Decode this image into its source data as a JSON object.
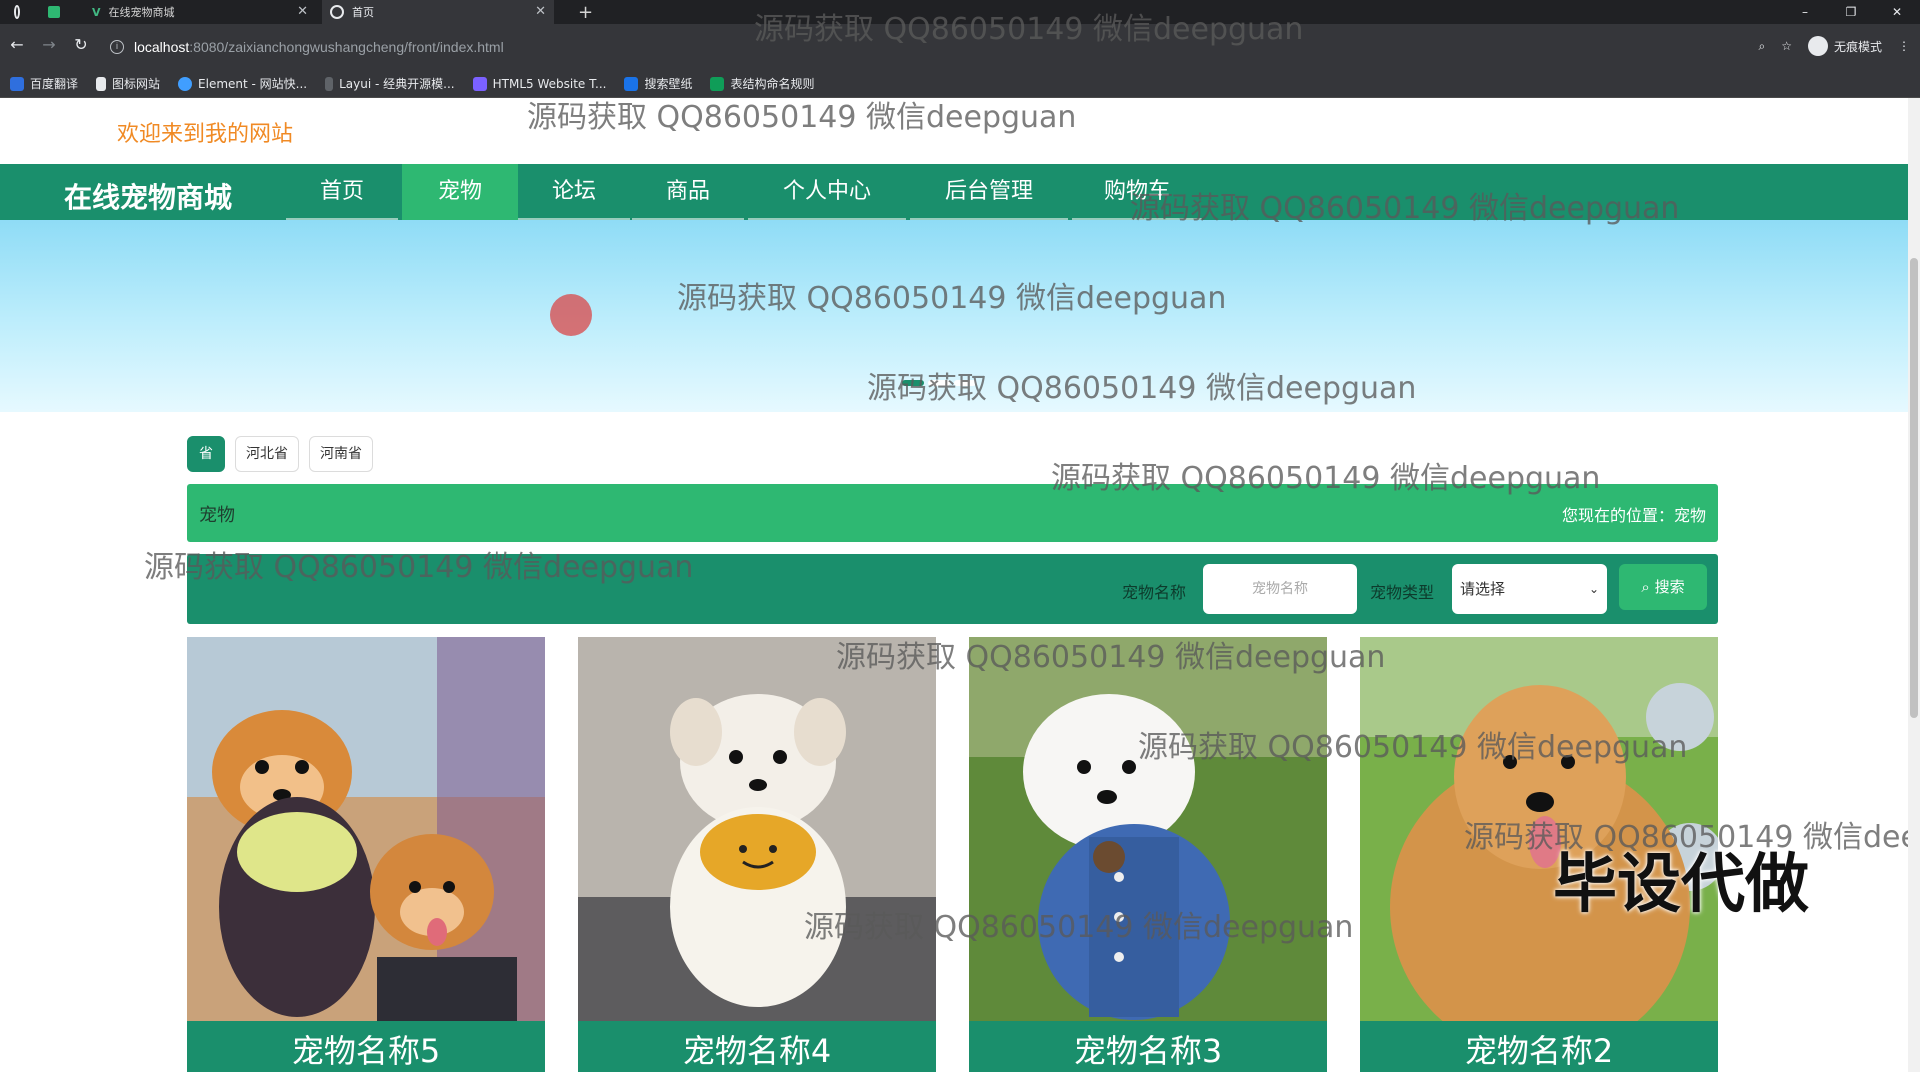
{
  "browser": {
    "tabs": [
      {
        "title": "在线宠物商城",
        "active": false
      },
      {
        "title": "首页",
        "active": true
      }
    ],
    "url_host": "localhost",
    "url_path": ":8080/zaixianchongwushangcheng/front/index.html",
    "incognito_label": "无痕模式",
    "bookmarks": [
      "百度翻译",
      "图标网站",
      "Element - 网站快...",
      "Layui - 经典开源模...",
      "HTML5 Website T...",
      "搜索壁纸",
      "表结构命名规则"
    ]
  },
  "site": {
    "welcome": "欢迎来到我的网站",
    "brand": "在线宠物商城",
    "nav": [
      {
        "label": "首页",
        "active": false
      },
      {
        "label": "宠物",
        "active": true
      },
      {
        "label": "论坛",
        "active": false
      },
      {
        "label": "商品",
        "active": false
      },
      {
        "label": "个人中心",
        "active": false
      },
      {
        "label": "后台管理",
        "active": false
      },
      {
        "label": "购物车",
        "active": false
      }
    ]
  },
  "filters": {
    "first": "省",
    "items": [
      "河北省",
      "河南省"
    ]
  },
  "crumb": {
    "title": "宠物",
    "location": "您现在的位置：宠物"
  },
  "search": {
    "name_label": "宠物名称",
    "name_placeholder": "宠物名称",
    "type_label": "宠物类型",
    "type_value": "请选择",
    "button": "搜索"
  },
  "pets": [
    {
      "name": "宠物名称5"
    },
    {
      "name": "宠物名称4"
    },
    {
      "name": "宠物名称3"
    },
    {
      "name": "宠物名称2"
    }
  ],
  "overlay": {
    "watermark": "源码获取 QQ86050149 微信deepguan",
    "stamp": "毕设代做"
  },
  "colors": {
    "primary": "#1a8f6c",
    "accent": "#2eb872",
    "welcome": "#f08a24"
  }
}
